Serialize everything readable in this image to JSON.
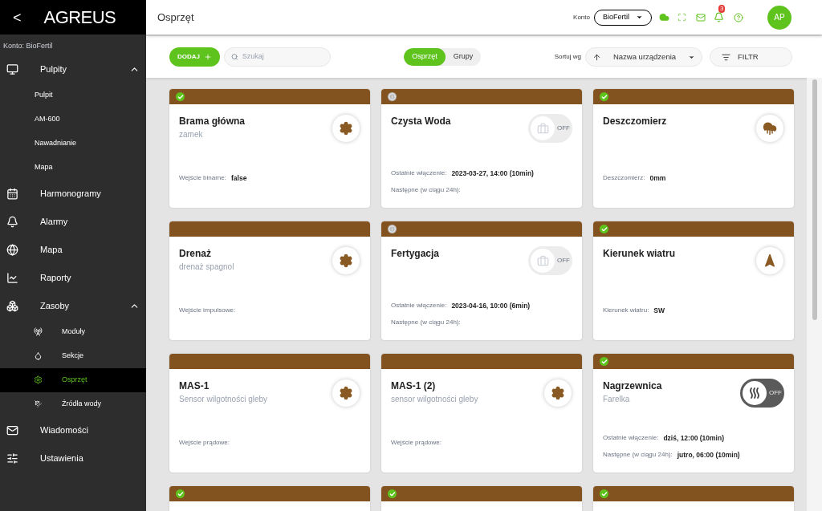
{
  "sidebar": {
    "back": "<",
    "logo": "AGREUS",
    "account": "Konto: BioFertil",
    "items": [
      {
        "label": "Pulpity",
        "expanded": true,
        "children": [
          {
            "label": "Pulpit",
            "selected": false
          },
          {
            "label": "AM-600",
            "selected": false
          },
          {
            "label": "Nawadnianie",
            "selected": false
          },
          {
            "label": "Mapa",
            "selected": false
          }
        ]
      },
      {
        "label": "Harmonogramy"
      },
      {
        "label": "Alarmy"
      },
      {
        "label": "Mapa"
      },
      {
        "label": "Raporty"
      },
      {
        "label": "Zasoby",
        "expanded": true,
        "children": [
          {
            "label": "Moduły",
            "selected": false
          },
          {
            "label": "Sekcje",
            "selected": false
          },
          {
            "label": "Osprzęt",
            "selected": true
          },
          {
            "label": "Źródła wody",
            "selected": false
          }
        ]
      },
      {
        "label": "Wiadomości"
      },
      {
        "label": "Ustawienia"
      }
    ]
  },
  "header": {
    "title": "Osprzęt",
    "account_label": "Konto",
    "account": "BioFertil",
    "notifications": "3",
    "avatar": "AP"
  },
  "toolbar": {
    "add": "DODAJ",
    "search": {
      "placeholder": "Szukaj"
    },
    "tabs": [
      {
        "label": "Osprzęt",
        "selected": true
      },
      {
        "label": "Grupy",
        "selected": false
      }
    ],
    "sort_label": "Sortuj wg",
    "sort": "Nazwa urządzenia",
    "filter": "FILTR"
  },
  "cards": [
    {
      "status": {
        "kind": "ok"
      },
      "title": "Brama główna",
      "subtitle": "zamek",
      "kind": "settings",
      "fields": [
        {
          "label": "Wejście binarne:",
          "value": "false"
        }
      ]
    },
    {
      "status": {
        "kind": "warning"
      },
      "title": "Czysta Woda",
      "kind": "toggle",
      "toggle": {
        "label": "OFF",
        "disabled": true
      },
      "fields": [
        {
          "label": "Ostatnie włączenie:",
          "value": "2023-03-27, 14:00 (10min)"
        },
        {
          "label": "Następne (w ciągu 24h):"
        }
      ]
    },
    {
      "status": {
        "kind": "ok"
      },
      "title": "Deszczomierz",
      "kind": "rain",
      "fields": [
        {
          "label": "Deszczomierz:",
          "value": "0mm"
        }
      ]
    },
    {
      "title": "Drenaż",
      "subtitle": "drenaż spagnol",
      "kind": "settings",
      "fields": [
        {
          "label": "Wejście impulsowe:"
        }
      ]
    },
    {
      "status": {
        "kind": "warning"
      },
      "title": "Fertygacja",
      "kind": "toggle",
      "toggle": {
        "label": "OFF",
        "disabled": true
      },
      "fields": [
        {
          "label": "Ostatnie włączenie:",
          "value": "2023-04-16, 10:00 (6min)"
        },
        {
          "label": "Następne (w ciągu 24h):"
        }
      ]
    },
    {
      "status": {
        "kind": "ok"
      },
      "title": "Kierunek wiatru",
      "kind": "wind",
      "fields": [
        {
          "label": "Kierunek wiatru:",
          "value": "SW"
        }
      ]
    },
    {
      "title": "MAS-1",
      "subtitle": "Sensor wilgotności gleby",
      "kind": "settings",
      "fields": [
        {
          "label": "Wejście prądowe:"
        }
      ]
    },
    {
      "title": "MAS-1 (2)",
      "subtitle": "sensor wilgotności gleby",
      "kind": "settings",
      "fields": [
        {
          "label": "Wejście prądowe:"
        }
      ]
    },
    {
      "status": {
        "kind": "ok"
      },
      "title": "Nagrzewnica",
      "subtitle": "Farelka",
      "kind": "heater",
      "toggle": {
        "label": "OFF",
        "disabled": false
      },
      "fields": [
        {
          "label": "Ostatnie włączenie:",
          "value": "dziś, 12:00 (10min)"
        },
        {
          "label": "Następne (w ciągu 24h):",
          "value": "jutro, 06:00 (10min)"
        }
      ]
    },
    {
      "status": {
        "kind": "ok"
      }
    },
    {
      "status": {
        "kind": "ok"
      }
    },
    {
      "status": {
        "kind": "ok"
      }
    }
  ]
}
